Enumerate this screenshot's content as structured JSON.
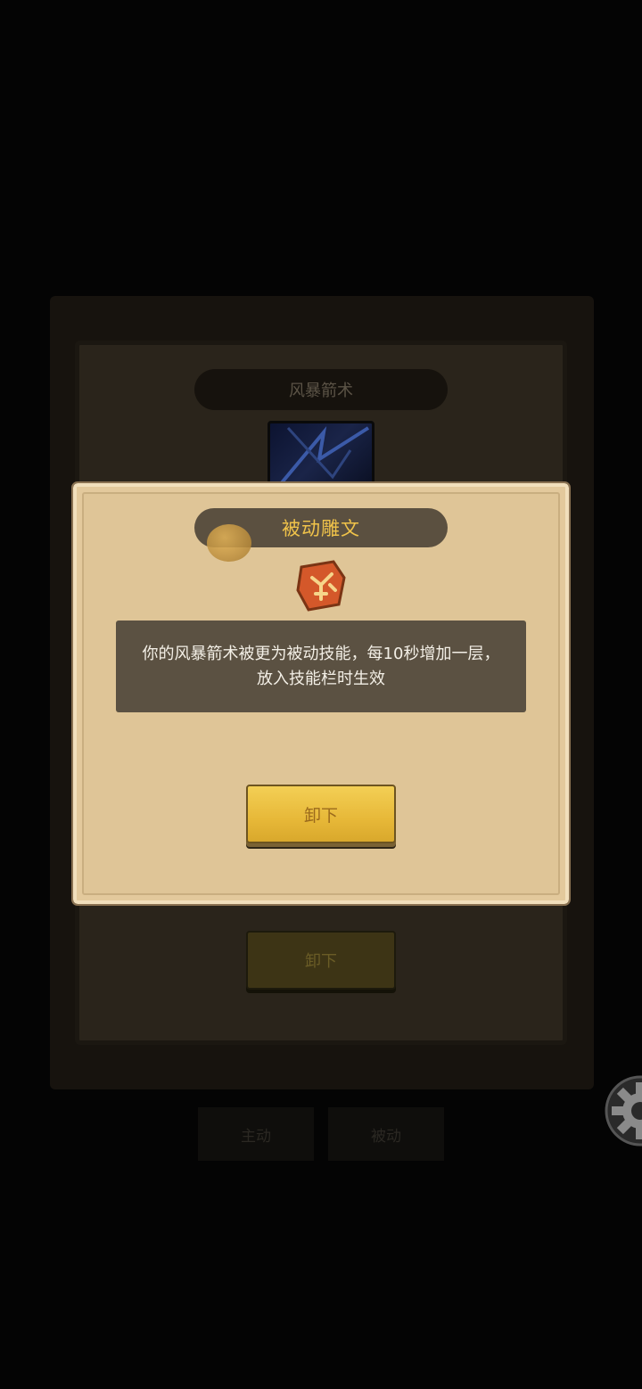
{
  "background": {
    "skill_title": "风暴箭术",
    "button_label": "卸下",
    "tabs": [
      {
        "label": "主动"
      },
      {
        "label": "被动"
      }
    ],
    "settings_icon": "gear-icon"
  },
  "modal": {
    "title": "被动雕文",
    "coin_icon": "coin-icon",
    "rune_icon": "rune-glyph-icon",
    "description": "你的风暴箭术被更为被动技能，每10秒增加一层，放入技能栏时生效",
    "button_label": "卸下"
  },
  "colors": {
    "modal_title": "#f0c34a",
    "button_gold": "#e7b838",
    "rune_orange": "#d4582a"
  }
}
